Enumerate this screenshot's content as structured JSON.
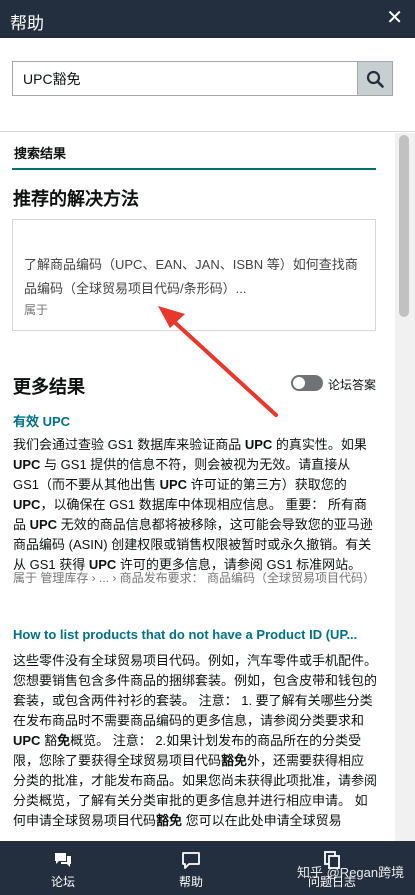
{
  "header": {
    "title": "帮助",
    "close_symbol": "✕"
  },
  "search": {
    "value": "UPC豁免",
    "placeholder": ""
  },
  "tab": {
    "label": "搜索结果"
  },
  "recommended": {
    "heading": "推荐的解决方法",
    "card": {
      "text": "了解商品编码（UPC、EAN、JAN、ISBN 等）如何查找商品编码（全球贸易项目代码/条形码）...",
      "meta": "属于"
    }
  },
  "more_results": {
    "heading": "更多结果",
    "forum_toggle_label": "论坛答案",
    "items": [
      {
        "title": "有效 UPC",
        "body": "我们会通过查验 GS1 数据库来验证商品 UPC 的真实性。如果 UPC 与 GS1 提供的信息不符，则会被视为无效。请直接从 GS1（而不要从其他出售 UPC 许可证的第三方）获取您的 UPC，以确保在 GS1 数据库中体现相应信息。 重要： 所有商品 UPC 无效的商品信息都将被移除，这可能会导致您的亚马逊商品编码 (ASIN) 创建权限或销售权限被暂时或永久撤销。有关从 GS1 获得 UPC 许可的更多信息，请参阅 GS1 标准网站。",
        "meta": "属于 管理库存 › ... › 商品发布要求： 商品编码（全球贸易项目代码）"
      },
      {
        "title": "How to list products that do not have a Product ID (UP...",
        "body": "这些零件没有全球贸易项目代码。例如，汽车零件或手机配件。 您想要销售包含多件商品的捆绑套装。例如，包含皮带和钱包的套装，或包含两件衬衫的套装。 注意： 1. 要了解有关哪些分类在发布商品时不需要商品编码的更多信息，请参阅分类要求和 UPC 豁免概览。 注意： 2.如果计划发布的商品所在的分类受限，您除了要获得全球贸易项目代码豁免外，还需要获得相应分类的批准，才能发布商品。如果您尚未获得此项批准，请参阅分类概览，了解有关分类审批的更多信息并进行相应申请。 如何申请全球贸易项目代码豁免 您可以在此处申请全球贸易"
      }
    ]
  },
  "bottom_nav": {
    "items": [
      {
        "label": "论坛",
        "icon": "forum-icon"
      },
      {
        "label": "帮助",
        "icon": "help-chat-icon"
      },
      {
        "label": "问题日志",
        "icon": "copy-log-icon"
      }
    ]
  },
  "watermark": {
    "text": "知乎 @Regan跨境"
  },
  "colors": {
    "header_bg": "#232f3e",
    "link": "#007185",
    "tab_underline": "#00706d",
    "arrow": "#e8372b"
  }
}
